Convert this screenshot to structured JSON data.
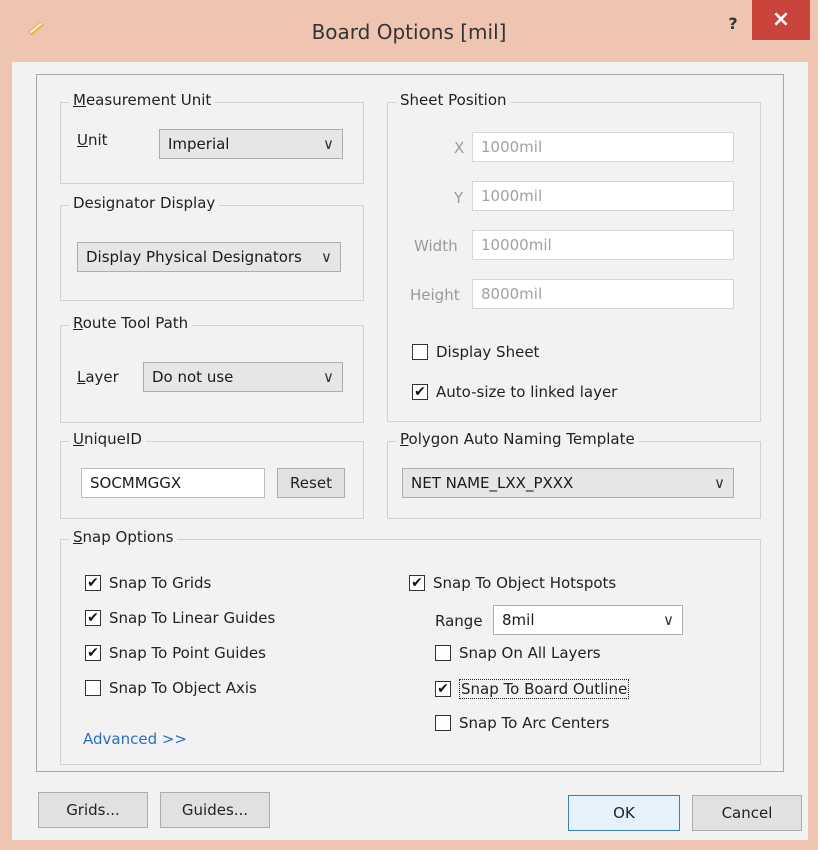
{
  "window": {
    "title": "Board Options [mil]",
    "help_label": "?",
    "close_label": "×"
  },
  "measurement_unit": {
    "legend": "Measurement Unit",
    "unit_label": "Unit",
    "unit_value": "Imperial"
  },
  "designator_display": {
    "legend": "Designator Display",
    "value": "Display Physical Designators"
  },
  "route_tool_path": {
    "legend": "Route Tool Path",
    "layer_label": "Layer",
    "layer_value": "Do not use"
  },
  "unique_id": {
    "legend": "UniqueID",
    "value": "SOCMMGGX",
    "reset_label": "Reset"
  },
  "sheet_position": {
    "legend": "Sheet Position",
    "x_label": "X",
    "x_value": "1000mil",
    "y_label": "Y",
    "y_value": "1000mil",
    "width_label": "Width",
    "width_value": "10000mil",
    "height_label": "Height",
    "height_value": "8000mil",
    "display_sheet_label": "Display Sheet",
    "display_sheet_checked": false,
    "auto_size_label": "Auto-size to linked layer",
    "auto_size_checked": true
  },
  "polygon_naming": {
    "legend": "Polygon Auto Naming Template",
    "value": "NET NAME_LXX_PXXX"
  },
  "snap_options": {
    "legend": "Snap Options",
    "left_items": [
      {
        "label": "Snap To Grids",
        "checked": true
      },
      {
        "label": "Snap To Linear Guides",
        "checked": true
      },
      {
        "label": "Snap To Point Guides",
        "checked": true
      },
      {
        "label": "Snap To Object Axis",
        "checked": false
      }
    ],
    "hotspots_label": "Snap To Object Hotspots",
    "hotspots_checked": true,
    "range_label": "Range",
    "range_value": "8mil",
    "right_items": [
      {
        "label": "Snap On All Layers",
        "checked": false
      },
      {
        "label": "Snap To Board Outline",
        "checked": true
      },
      {
        "label": "Snap To Arc Centers",
        "checked": false
      }
    ],
    "advanced_label": "Advanced >>"
  },
  "footer": {
    "grids_label": "Grids...",
    "guides_label": "Guides...",
    "ok_label": "OK",
    "cancel_label": "Cancel"
  },
  "check_glyph": "✔",
  "colors": {
    "titlebar": "#efc5b2",
    "close_button": "#c9453b",
    "link": "#2b6ec4",
    "default_button_border": "#3c7fb1"
  }
}
